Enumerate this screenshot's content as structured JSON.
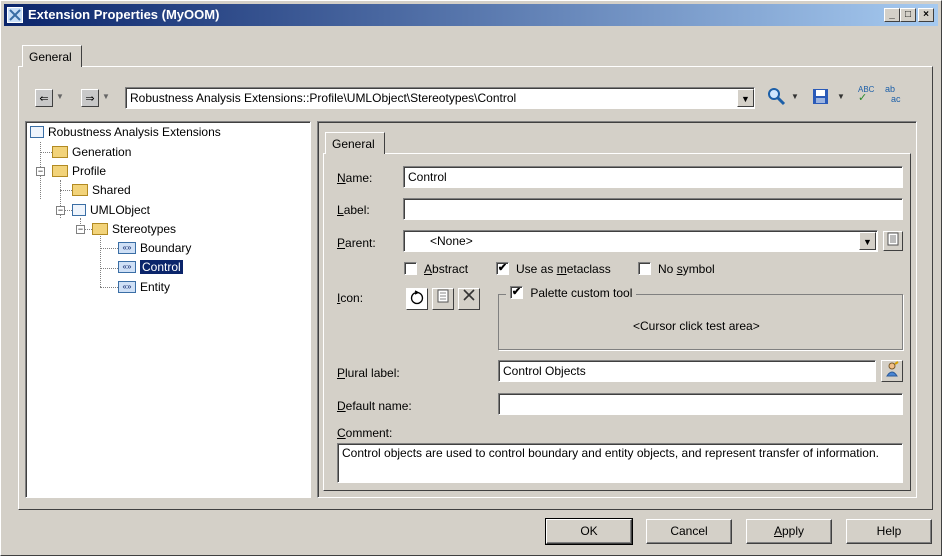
{
  "window": {
    "title": "Extension Properties (MyOOM)",
    "minimize_glyph": "_",
    "maximize_glyph": "□",
    "close_glyph": "×"
  },
  "outer_tab": {
    "label": "General"
  },
  "toolbar": {
    "path": "Robustness Analysis Extensions::Profile\\UMLObject\\Stereotypes\\Control",
    "spell_check_label": "ABC",
    "spell_check_mark": "✓",
    "find_replace_label": "ab",
    "find_replace_sub": "ac"
  },
  "tree": {
    "root": "Robustness Analysis Extensions",
    "generation": "Generation",
    "profile": "Profile",
    "shared": "Shared",
    "umlobject": "UMLObject",
    "stereotypes": "Stereotypes",
    "boundary": "Boundary",
    "control": "Control",
    "entity": "Entity",
    "stereo_tag": "«»",
    "collapse_glyph": "−"
  },
  "inner_tab": {
    "label": "General"
  },
  "form": {
    "name_label": "Name:",
    "name_accel": "N",
    "name_rest": "ame:",
    "name_value": "Control",
    "label_label": "Label:",
    "label_accel": "L",
    "label_rest": "abel:",
    "label_value": "",
    "parent_label": "Parent:",
    "parent_accel": "P",
    "parent_rest": "arent:",
    "parent_value": "<None>",
    "abstract_label": "Abstract",
    "abstract_accel": "A",
    "abstract_rest": "bstract",
    "abstract_checked": false,
    "metaclass_pre": "Use as ",
    "metaclass_accel": "m",
    "metaclass_rest": "etaclass",
    "metaclass_checked": true,
    "nosymbol_pre": "No ",
    "nosymbol_accel": "s",
    "nosymbol_rest": "ymbol",
    "nosymbol_checked": false,
    "icon_label": "Icon:",
    "icon_accel": "I",
    "icon_rest": "con:",
    "palette_label": "Palette custom tool",
    "palette_checked": true,
    "cursor_test": "<Cursor click test area>",
    "plural_accel": "P",
    "plural_rest": "lural label:",
    "plural_value": "Control Objects",
    "default_accel": "D",
    "default_rest": "efault name:",
    "default_value": "",
    "comment_accel": "C",
    "comment_rest": "omment:",
    "comment_value": "Control objects are used to control boundary and entity objects, and represent transfer of information.",
    "check_mark": "✔",
    "dropdown_arrow": "▼"
  },
  "buttons": {
    "ok": "OK",
    "cancel": "Cancel",
    "apply_accel": "A",
    "apply_rest": "pply",
    "help": "Help"
  }
}
